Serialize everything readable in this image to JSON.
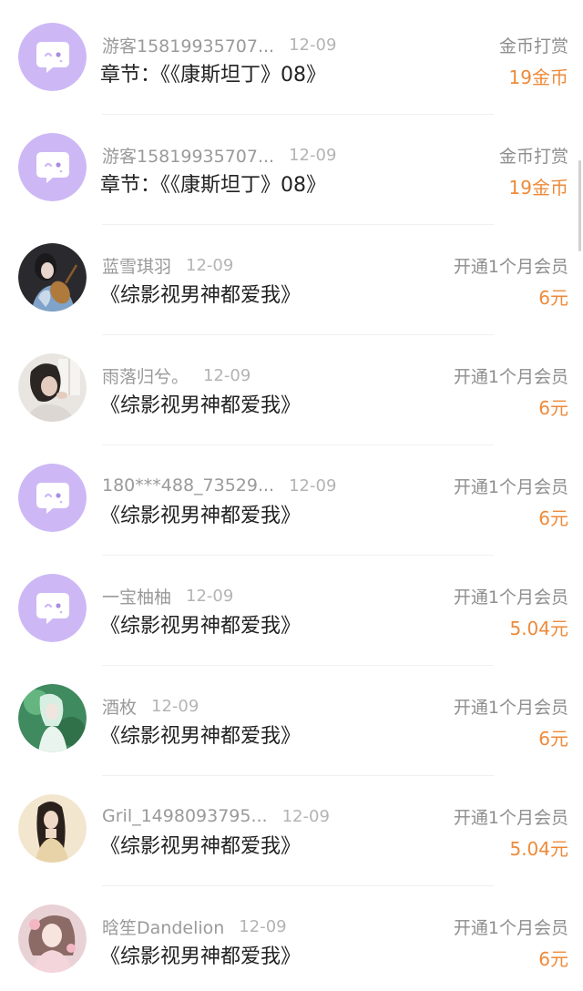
{
  "items": [
    {
      "user": "游客15819935707...",
      "date": "12-09",
      "title": "章节：《《康斯坦丁》08》",
      "type": "金币打赏",
      "amount": "19金币",
      "avatar": "default-chat-icon"
    },
    {
      "user": "游客15819935707...",
      "date": "12-09",
      "title": "章节：《《康斯坦丁》08》",
      "type": "金币打赏",
      "amount": "19金币",
      "avatar": "default-chat-icon"
    },
    {
      "user": "蓝雪琪羽",
      "date": "12-09",
      "title": "《综影视男神都爱我》",
      "type": "开通1个月会员",
      "amount": "6元",
      "avatar": "photo-lute-player"
    },
    {
      "user": "雨落归兮。",
      "date": "12-09",
      "title": "《综影视男神都爱我》",
      "type": "开通1个月会员",
      "amount": "6元",
      "avatar": "photo-girl-window"
    },
    {
      "user": "180***488_73529...",
      "date": "12-09",
      "title": "《综影视男神都爱我》",
      "type": "开通1个月会员",
      "amount": "6元",
      "avatar": "default-chat-icon"
    },
    {
      "user": "一宝柚柚",
      "date": "12-09",
      "title": "《综影视男神都爱我》",
      "type": "开通1个月会员",
      "amount": "5.04元",
      "avatar": "default-chat-icon"
    },
    {
      "user": "酒枚",
      "date": "12-09",
      "title": "《综影视男神都爱我》",
      "type": "开通1个月会员",
      "amount": "6元",
      "avatar": "photo-green-fantasy"
    },
    {
      "user": "Gril_1498093795...",
      "date": "12-09",
      "title": "《综影视男神都爱我》",
      "type": "开通1个月会员",
      "amount": "5.04元",
      "avatar": "photo-girl-portrait"
    },
    {
      "user": "晗笙Dandelion",
      "date": "12-09",
      "title": "《综影视男神都爱我》",
      "type": "开通1个月会员",
      "amount": "6元",
      "avatar": "photo-anime-girl"
    }
  ],
  "colors": {
    "amount": "#ee8a3a",
    "default_avatar_bg": "#cdb8f5",
    "title": "#222222",
    "secondary": "#9a9a9a"
  }
}
